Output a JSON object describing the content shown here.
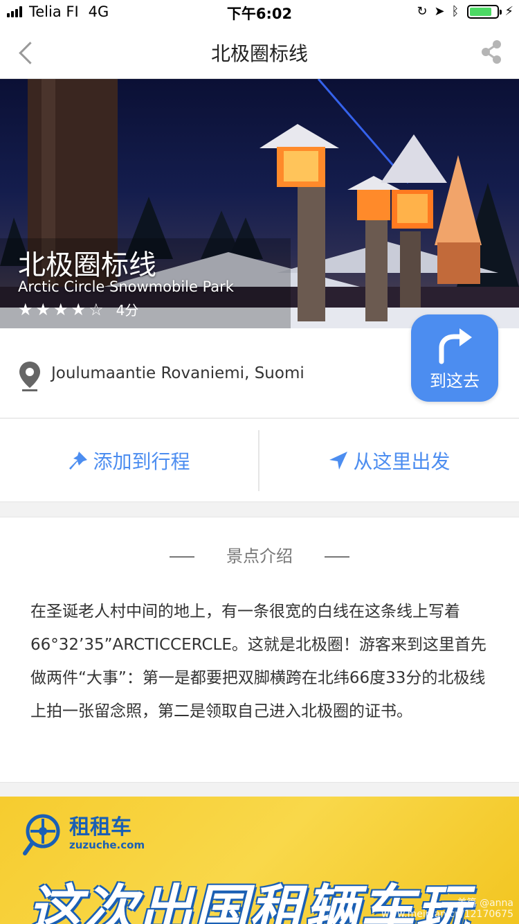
{
  "status_bar": {
    "carrier": "Telia FI",
    "network": "4G",
    "time": "下午6:02",
    "icons": [
      "signal-icon",
      "orientation-lock-icon",
      "location-arrow-icon",
      "bluetooth-icon",
      "battery-icon",
      "charging-bolt-icon"
    ],
    "battery_level": 0.8
  },
  "nav": {
    "title": "北极圈标线",
    "back_icon": "chevron-left-icon",
    "share_icon": "share-icon"
  },
  "hero": {
    "title": "北极圈标线",
    "subtitle": "Arctic Circle Snowmobile Park",
    "rating": 4,
    "rating_max": 5,
    "score_text": "4分"
  },
  "location": {
    "address": "Joulumaantie Rovaniemi, Suomi",
    "go_label": "到这去"
  },
  "actions": {
    "add_label": "添加到行程",
    "start_label": "从这里出发"
  },
  "intro": {
    "heading": "景点介绍",
    "text": "在圣诞老人村中间的地上，有一条很宽的白线在这条线上写着66°32’35”ARCTICCERCLE。这就是北极圈！游客来到这里首先做两件“大事”：第一是都要把双脚横跨在北纬66度33分的北极线上拍一张留念照，第二是领取自己进入北极圈的证书。"
  },
  "ad": {
    "brand": "租租车",
    "domain": "zuzuche.com",
    "headline": "这次出国租辆车玩",
    "watermark_line1": "美篇 @anna",
    "watermark_line2": "www.meipian.cn/12170675"
  },
  "colors": {
    "accent": "#4c8df0",
    "ad_yellow": "#f6cc2f",
    "ad_blue": "#1a5fb4"
  }
}
